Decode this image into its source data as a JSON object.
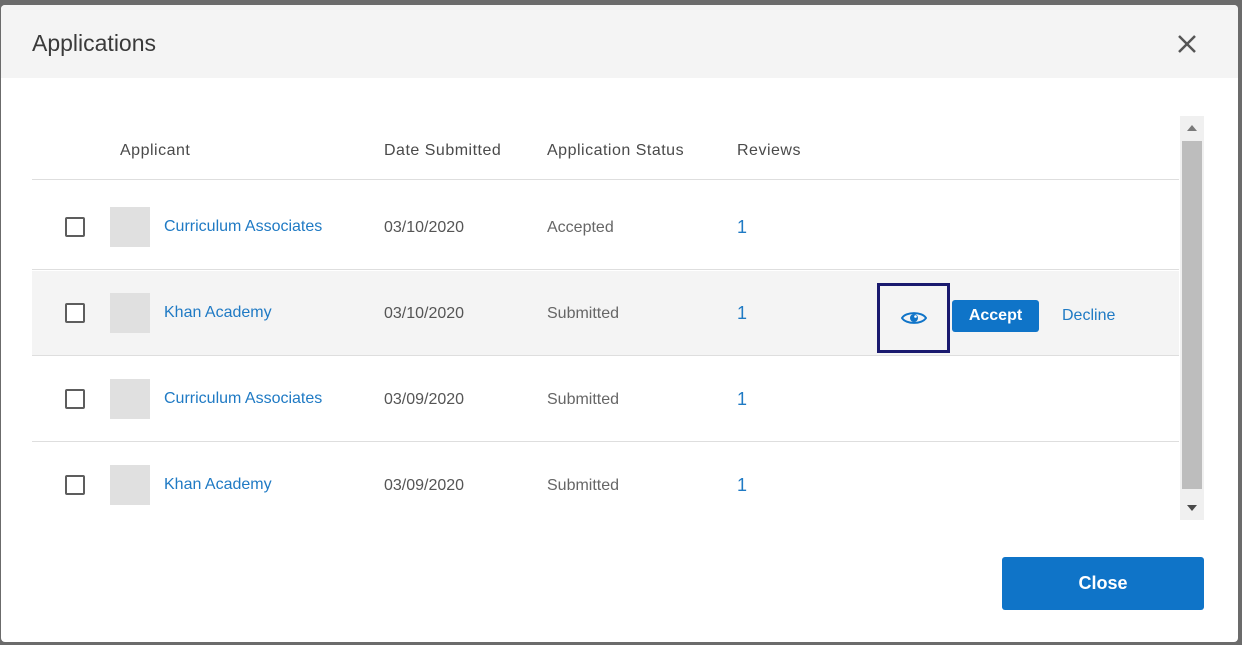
{
  "dialog": {
    "title": "Applications",
    "close_icon": "close-icon",
    "close_button_label": "Close"
  },
  "table": {
    "headers": {
      "applicant": "Applicant",
      "date": "Date Submitted",
      "status": "Application Status",
      "reviews": "Reviews"
    },
    "rows": [
      {
        "applicant": "Curriculum Associates",
        "date": "03/10/2020",
        "status": "Accepted",
        "reviews": "1"
      },
      {
        "applicant": "Khan Academy",
        "date": "03/10/2020",
        "status": "Submitted",
        "reviews": "1"
      },
      {
        "applicant": "Curriculum Associates",
        "date": "03/09/2020",
        "status": "Submitted",
        "reviews": "1"
      },
      {
        "applicant": "Khan Academy",
        "date": "03/09/2020",
        "status": "Submitted",
        "reviews": "1"
      }
    ],
    "row_actions": {
      "view_icon": "eye-icon",
      "accept_label": "Accept",
      "decline_label": "Decline"
    }
  },
  "colors": {
    "accent": "#0f74c8",
    "link": "#1f7ac4",
    "focus_outline": "#1a1a6e"
  }
}
